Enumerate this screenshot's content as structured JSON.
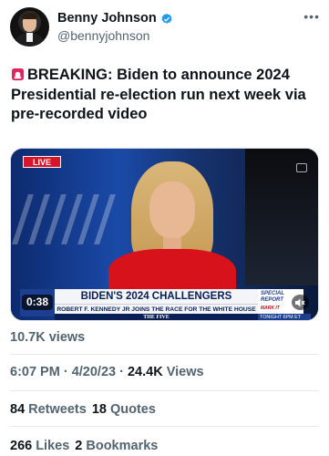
{
  "author": {
    "display_name": "Benny Johnson",
    "handle": "@bennyjohnson"
  },
  "tweet": {
    "text": "BREAKING: Biden to announce 2024 Presidential re-election run next week via pre-recorded video"
  },
  "media": {
    "live_label": "LIVE",
    "headline": "BIDEN'S 2024 CHALLENGERS",
    "subheadline": "ROBERT F. KENNEDY JR JOINS THE RACE FOR THE WHITE HOUSE",
    "show_name": "THE FIVE",
    "special_report": "SPECIAL REPORT",
    "special_mark": "MARK IT",
    "tonight": "TONIGHT 6PM ET",
    "timecode": "0:38"
  },
  "stats": {
    "views_label": "10.7K views",
    "time": "6:07 PM",
    "date": "4/20/23",
    "views_count": "24.4K",
    "views_word": "Views",
    "retweets_count": "84",
    "retweets_label": "Retweets",
    "quotes_count": "18",
    "quotes_label": "Quotes",
    "likes_count": "266",
    "likes_label": "Likes",
    "bookmarks_count": "2",
    "bookmarks_label": "Bookmarks"
  },
  "colors": {
    "verified": "#1d9bf0",
    "text_primary": "#0f1419",
    "text_secondary": "#536471",
    "siren": "#e0245e"
  }
}
